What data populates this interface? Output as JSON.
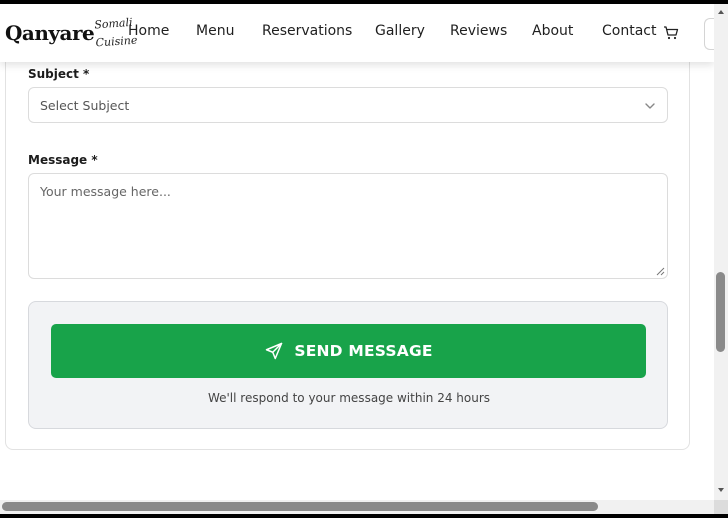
{
  "brand": {
    "name": "Qanyare",
    "tagline_line1": "Somali",
    "tagline_line2": "Cuisine"
  },
  "nav": {
    "items": [
      "Home",
      "Menu",
      "Reservations",
      "Gallery",
      "Reviews",
      "About",
      "Contact"
    ],
    "cart_icon": "cart-icon"
  },
  "form": {
    "subject_label": "Subject *",
    "subject_placeholder": "Select Subject",
    "message_label": "Message *",
    "message_placeholder": "Your message here..."
  },
  "submit": {
    "button_label": "SEND MESSAGE",
    "button_icon": "send-icon",
    "note": "We'll respond to your message within 24 hours"
  },
  "colors": {
    "accent": "#18a34a",
    "panel_bg": "#f2f3f5",
    "text": "#1c1c1c"
  }
}
